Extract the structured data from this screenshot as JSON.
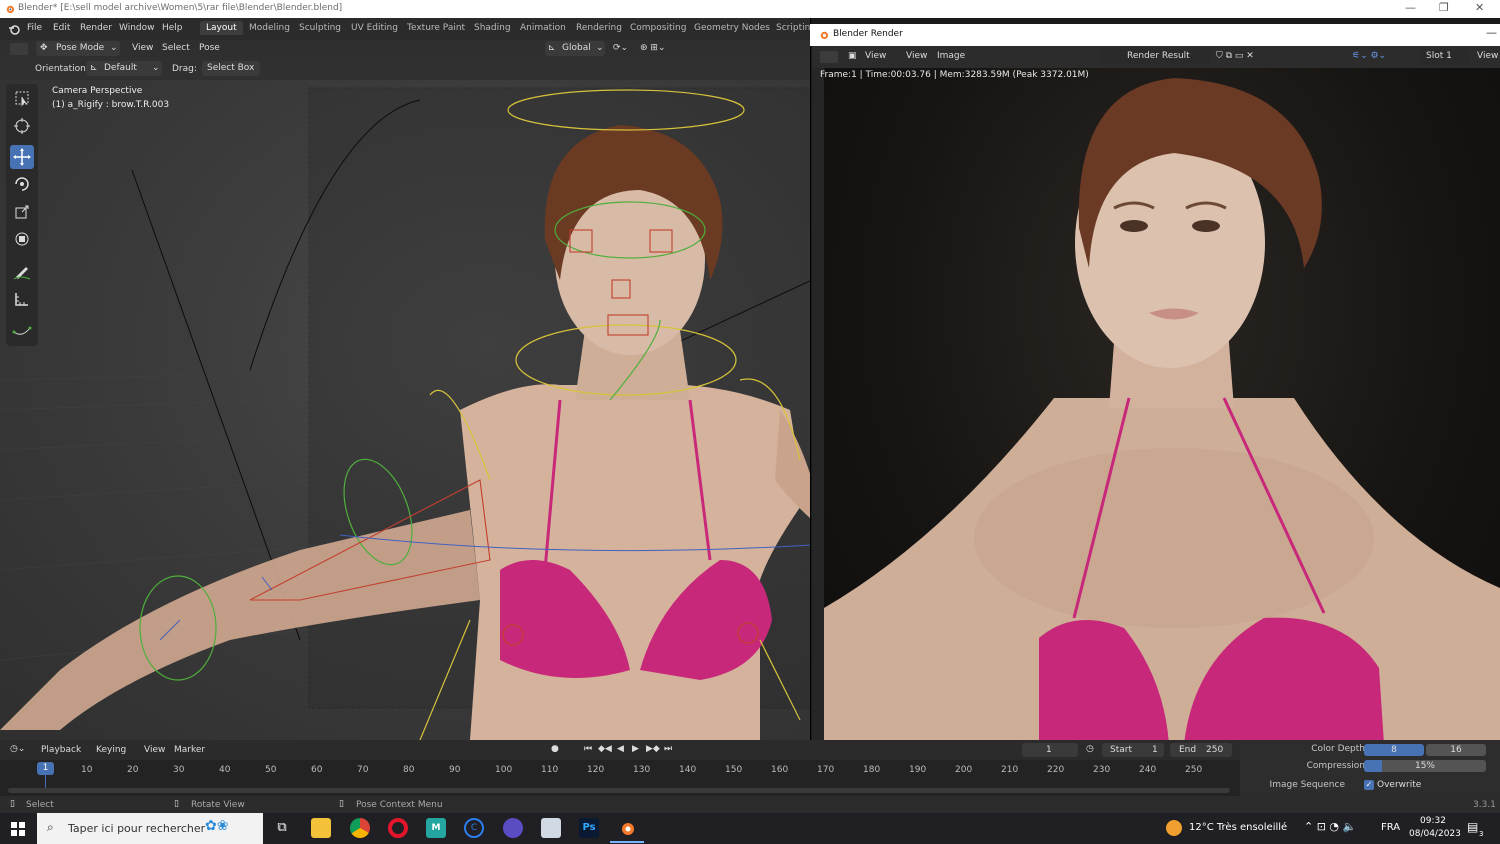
{
  "window": {
    "title": "Blender* [E:\\sell model archive\\Women\\5\\rar file\\Blender\\Blender.blend]"
  },
  "topmenu": [
    "File",
    "Edit",
    "Render",
    "Window",
    "Help"
  ],
  "workspaces": [
    "Layout",
    "Modeling",
    "Sculpting",
    "UV Editing",
    "Texture Paint",
    "Shading",
    "Animation",
    "Rendering",
    "Compositing",
    "Geometry Nodes",
    "Scripting"
  ],
  "viewport_header": {
    "mode": "Pose Mode",
    "menus": [
      "View",
      "Select",
      "Pose"
    ],
    "transform_orientation": "Global",
    "orientation_label": "Orientation:",
    "orientation_value": "Default",
    "drag_label": "Drag:",
    "drag_value": "Select Box"
  },
  "viewport": {
    "camera_label": "Camera Perspective",
    "active_object": "(1) a_Rigify : brow.T.R.003"
  },
  "render_window": {
    "title": "Blender Render",
    "menus": [
      "View",
      "View",
      "Image"
    ],
    "image_name": "Render Result",
    "slot": "Slot 1",
    "view_label": "View",
    "stats": "Frame:1 | Time:00:03.76 | Mem:3283.59M (Peak 3372.01M)"
  },
  "timeline": {
    "menus": [
      "Playback",
      "Keying",
      "View",
      "Marker"
    ],
    "current_frame": "1",
    "start_label": "Start",
    "start": "1",
    "end_label": "End",
    "end": "250",
    "ticks": [
      "10",
      "20",
      "30",
      "40",
      "50",
      "60",
      "70",
      "80",
      "90",
      "100",
      "110",
      "120",
      "130",
      "140",
      "150",
      "160",
      "170",
      "180",
      "190",
      "200",
      "210",
      "220",
      "230",
      "240",
      "250"
    ]
  },
  "output_props": {
    "color_depth_label": "Color Depth",
    "color_depth_options": [
      "8",
      "16"
    ],
    "compression_label": "Compression",
    "compression_value": "15%",
    "compression_fill": 0.15,
    "image_sequence_label": "Image Sequence",
    "overwrite_label": "Overwrite"
  },
  "statusbar": {
    "select": "Select",
    "rotate": "Rotate View",
    "context": "Pose Context Menu",
    "version": "3.3.1"
  },
  "taskbar": {
    "search_placeholder": "Taper ici pour rechercher",
    "weather": "12°C  Très ensoleillé",
    "lang": "FRA",
    "time": "09:32",
    "date": "08/04/2023",
    "notif_count": "3"
  },
  "colors": {
    "accent": "#4772b3",
    "bikini": "#c8287a",
    "rig_yellow": "#d6c23a",
    "rig_green": "#4fae3c",
    "rig_red": "#c2402f"
  }
}
